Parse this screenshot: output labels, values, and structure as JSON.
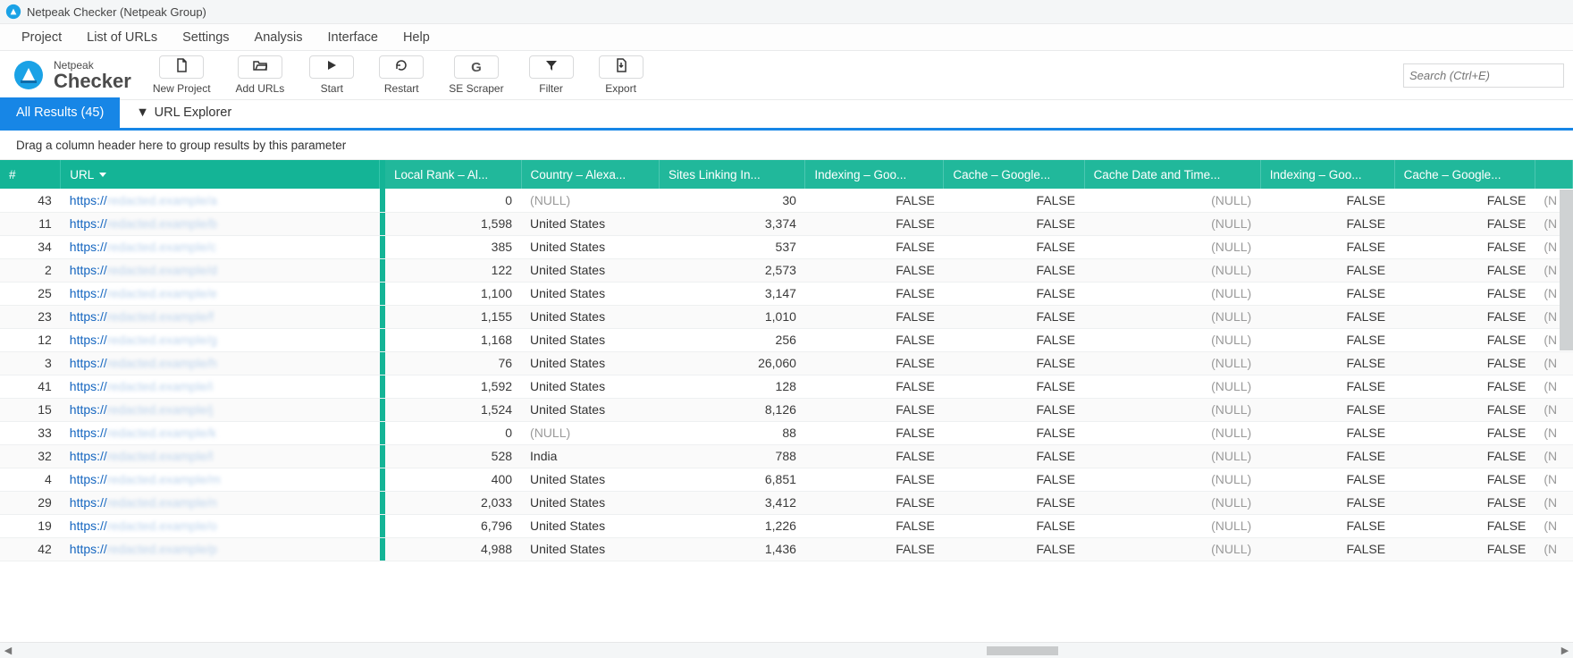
{
  "window": {
    "title": "Netpeak Checker (Netpeak Group)"
  },
  "brand": {
    "line1": "Netpeak",
    "line2": "Checker"
  },
  "menu": {
    "project": "Project",
    "list": "List of URLs",
    "settings": "Settings",
    "analysis": "Analysis",
    "interface": "Interface",
    "help": "Help"
  },
  "toolbar": {
    "new_project": "New Project",
    "add_urls": "Add URLs",
    "start": "Start",
    "restart": "Restart",
    "scraper": "SE Scraper",
    "filter": "Filter",
    "export": "Export"
  },
  "search": {
    "placeholder": "Search (Ctrl+E)"
  },
  "tabs": {
    "all_results": "All Results (45)",
    "url_explorer": "URL Explorer"
  },
  "group_strip": "Drag a column header here to group results by this parameter",
  "columns": {
    "idx": "#",
    "url": "URL",
    "local_rank": "Local Rank  –  Al...",
    "country": "Country  –  Alexa...",
    "sites_in": "Sites Linking In...",
    "indexing1": "Indexing  –  Goo...",
    "cache1": "Cache  –  Google...",
    "cache_date": "Cache Date and Time...",
    "indexing2": "Indexing  –  Goo...",
    "cache2": "Cache  –  Google...",
    "overflow": "(N"
  },
  "null_text": "(NULL)",
  "false_text": "FALSE",
  "rows": [
    {
      "idx": 43,
      "url": "redacted.example/a",
      "local": "0",
      "country": null,
      "sites": "30"
    },
    {
      "idx": 11,
      "url": "redacted.example/b",
      "local": "1,598",
      "country": "United States",
      "sites": "3,374"
    },
    {
      "idx": 34,
      "url": "redacted.example/c",
      "local": "385",
      "country": "United States",
      "sites": "537"
    },
    {
      "idx": 2,
      "url": "redacted.example/d",
      "local": "122",
      "country": "United States",
      "sites": "2,573"
    },
    {
      "idx": 25,
      "url": "redacted.example/e",
      "local": "1,100",
      "country": "United States",
      "sites": "3,147"
    },
    {
      "idx": 23,
      "url": "redacted.example/f",
      "local": "1,155",
      "country": "United States",
      "sites": "1,010"
    },
    {
      "idx": 12,
      "url": "redacted.example/g",
      "local": "1,168",
      "country": "United States",
      "sites": "256"
    },
    {
      "idx": 3,
      "url": "redacted.example/h",
      "local": "76",
      "country": "United States",
      "sites": "26,060"
    },
    {
      "idx": 41,
      "url": "redacted.example/i",
      "local": "1,592",
      "country": "United States",
      "sites": "128"
    },
    {
      "idx": 15,
      "url": "redacted.example/j",
      "local": "1,524",
      "country": "United States",
      "sites": "8,126"
    },
    {
      "idx": 33,
      "url": "redacted.example/k",
      "local": "0",
      "country": null,
      "sites": "88"
    },
    {
      "idx": 32,
      "url": "redacted.example/l",
      "local": "528",
      "country": "India",
      "sites": "788"
    },
    {
      "idx": 4,
      "url": "redacted.example/m",
      "local": "400",
      "country": "United States",
      "sites": "6,851"
    },
    {
      "idx": 29,
      "url": "redacted.example/n",
      "local": "2,033",
      "country": "United States",
      "sites": "3,412"
    },
    {
      "idx": 19,
      "url": "redacted.example/o",
      "local": "6,796",
      "country": "United States",
      "sites": "1,226"
    },
    {
      "idx": 42,
      "url": "redacted.example/p",
      "local": "4,988",
      "country": "United States",
      "sites": "1,436"
    }
  ]
}
